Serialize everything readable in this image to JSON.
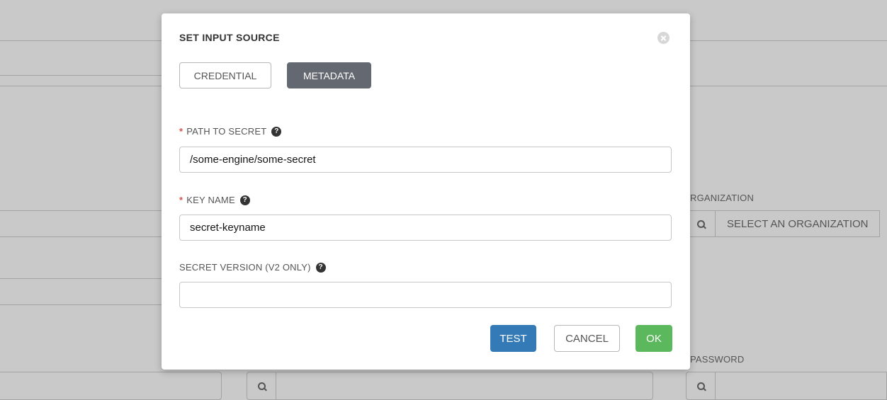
{
  "background": {
    "organization_label": "RGANIZATION",
    "organization_placeholder": "SELECT AN ORGANIZATION",
    "password_label": "PASSWORD",
    "search_icon": "search-icon"
  },
  "modal": {
    "title": "SET INPUT SOURCE",
    "close_icon": "close-icon",
    "tabs": [
      {
        "label": "CREDENTIAL",
        "active": false
      },
      {
        "label": "METADATA",
        "active": true
      }
    ],
    "fields": [
      {
        "label": "PATH TO SECRET",
        "required": true,
        "value": "/some-engine/some-secret"
      },
      {
        "label": "KEY NAME",
        "required": true,
        "value": "secret-keyname"
      },
      {
        "label": "SECRET VERSION (V2 ONLY)",
        "required": false,
        "value": ""
      }
    ],
    "required_marker": "*",
    "help_glyph": "?",
    "buttons": {
      "test": "TEST",
      "cancel": "CANCEL",
      "ok": "OK"
    }
  },
  "colors": {
    "overlay": "#c9c9c9",
    "primary": "#337ab7",
    "success": "#5cb85c",
    "active_tab": "#646870",
    "required": "#d9534f"
  }
}
